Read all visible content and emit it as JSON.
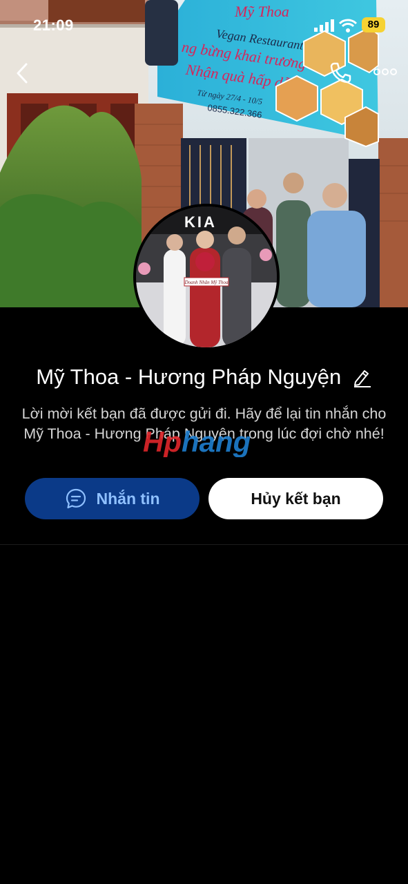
{
  "status_bar": {
    "time": "21:09",
    "battery": "89"
  },
  "cover": {
    "banner_line1": "Mỹ Thoa",
    "banner_line2": "Vegan Restaurant",
    "banner_line3": "ng bừng khai trương",
    "banner_line4": "Nhận quà hấp dẫn",
    "banner_date": "Từ ngày 27/4 - 10/5",
    "banner_phone": "0855.322.366"
  },
  "avatar_photo": {
    "logo_text": "KIA",
    "sign_text": "Doanh Nhân Mỹ Thoa"
  },
  "profile": {
    "name": "Mỹ Thoa - Hương Pháp Nguyện"
  },
  "notice": "Lời mời kết bạn đã được gửi đi. Hãy để lại tin nhắn cho Mỹ Thoa - Hương Pháp Nguyện trong lúc đợi chờ nhé!",
  "watermark": {
    "part1": "Hp",
    "part2": "hang"
  },
  "actions": {
    "message_label": "Nhắn tin",
    "cancel_label": "Hủy kết bạn"
  },
  "colors": {
    "message_bg": "#0b3a88",
    "message_text": "#8fc0ff",
    "battery": "#f6d233"
  }
}
